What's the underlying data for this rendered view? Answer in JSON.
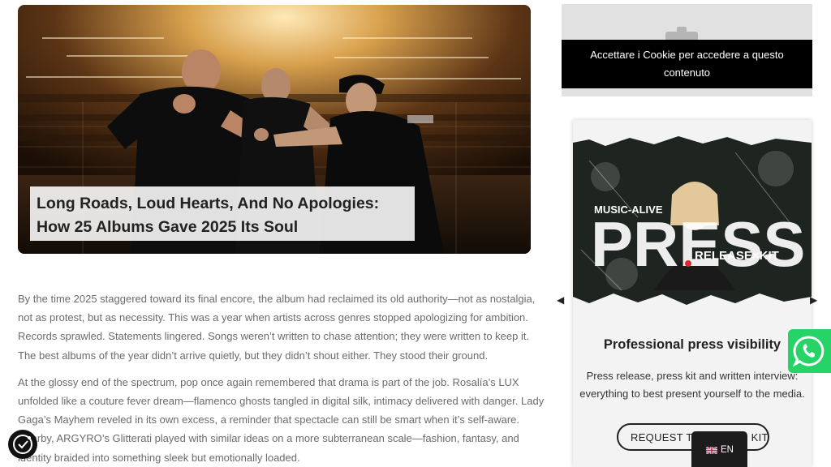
{
  "hero": {
    "title_line1": "Long Roads, Loud Hearts, And No Apologies:",
    "title_line2": "How 25 Albums Gave 2025 Its Soul"
  },
  "article": {
    "paragraphs": [
      {
        "lines": [
          "By the time 2025 staggered toward its final encore, the album had reclaimed its old authority—not as nostalgia,",
          "not as protest, but as necessity. This was a year when artists across genres stopped apologizing for ambition.",
          "Records sprawled. Statements lingered. Songs weren’t written to chase attention; they were written to keep it.",
          "The best albums of the year didn’t arrive quietly, but they didn’t shout either. They stood their ground."
        ]
      },
      {
        "lines": [
          "At the glossy end of the spectrum, pop once again remembered that drama is part of the job. Rosalía’s LUX",
          "unfolded like a couture fever dream—flamenco ghosts tangled in digital silk, intimacy delivered with danger. Lady",
          "Gaga’s Mayhem reveled in its own excess, a reminder that spectacle can still be smart when it’s self-aware.",
          "Nearby, ARGYRO’s Glitterati played with similar ideas on a more subterranean scale—fashion, fantasy, and",
          "identity braided into something sleek but emotionally loaded."
        ]
      }
    ]
  },
  "sidebar": {
    "cookie_notice": {
      "line1": "Accettare i Cookie per accedere a questo",
      "line2": "contenuto"
    },
    "promo": {
      "art_brand": "MUSIC-ALIVE",
      "art_word": "PRESS",
      "art_sub": "RELEASE×KIT",
      "heading": "Professional press visibility",
      "text_line1": "Press release, press kit and written interview:",
      "text_line2": "everything to best present yourself to the media.",
      "cta_label": "REQUEST THE PRESS KIT"
    },
    "carousel": {
      "prev_icon": "caret-left-icon",
      "next_icon": "caret-right-icon"
    }
  },
  "widgets": {
    "whatsapp_icon": "whatsapp-icon",
    "whatsapp_color": "#26d367",
    "consent_icon": "cookie-consent-icon",
    "language": {
      "code": "EN",
      "flag": "uk-flag-icon"
    }
  }
}
